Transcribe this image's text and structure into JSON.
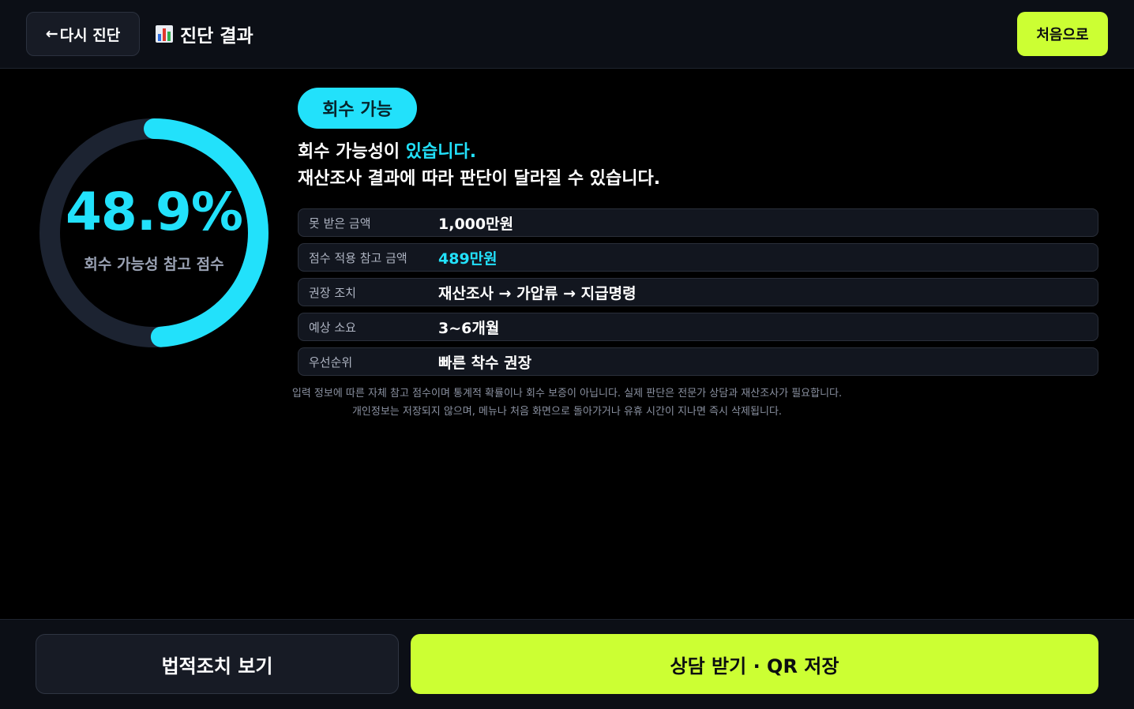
{
  "header": {
    "back_arrow": "←",
    "back_label": "다시 진단",
    "title": "진단 결과",
    "title_icon": "bar-chart-icon",
    "home_label": "처음으로"
  },
  "gauge": {
    "value_text": "48.9%",
    "value": 48.9,
    "label": "회수 가능성 참고 점수",
    "track_color": "#1c2331",
    "fill_color": "#22e1fb"
  },
  "result": {
    "badge": "회수 가능",
    "headline_prefix": "회수 가능성이 ",
    "headline_highlight": "있습니다.",
    "headline_line2": "재산조사 결과에 따라 판단이 달라질 수 있습니다."
  },
  "info_rows": [
    {
      "key": "못 받은 금액",
      "value": "1,000만원",
      "accent": false
    },
    {
      "key": "점수 적용 참고 금액",
      "value": "489만원",
      "accent": true
    },
    {
      "key": "권장 조치",
      "value": "재산조사 → 가압류 → 지급명령",
      "accent": false
    },
    {
      "key": "예상 소요",
      "value": "3~6개월",
      "accent": false
    },
    {
      "key": "우선순위",
      "value": "빠른 착수 권장",
      "accent": false
    }
  ],
  "disclaimer": {
    "line1": "입력 정보에 따른 자체 참고 점수이며 통계적 확률이나 회수 보증이 아닙니다. 실제 판단은 전문가 상담과 재산조사가 필요합니다.",
    "line2": "개인정보는 저장되지 않으며, 메뉴나 처음 화면으로 돌아가거나 유휴 시간이 지나면 즉시 삭제됩니다."
  },
  "footer": {
    "legal_label": "법적조치 보기",
    "consult_label": "상담 받기 · QR 저장"
  },
  "colors": {
    "accent_cyan": "#22e1fb",
    "accent_lime": "#ccff33",
    "background": "#000000"
  }
}
